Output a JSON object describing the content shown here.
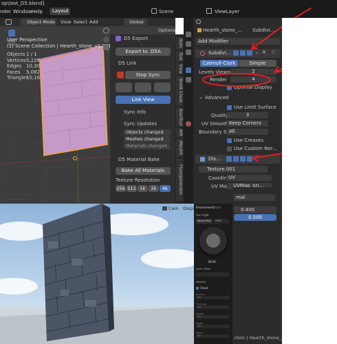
{
  "topbar": {
    "file_title": "op\\test_D5.blend]",
    "menu": [
      "nder",
      "Window",
      "Help"
    ],
    "layout_tab": "Layout",
    "scene": "Scene",
    "view_layer": "ViewLayer"
  },
  "viewport_header": {
    "mode": "Object Mode",
    "menus": [
      "View",
      "Select",
      "Add"
    ],
    "orientation": "Global",
    "options": "Options"
  },
  "overlay": {
    "perspective": "User Perspective",
    "collection": "(1) Scene Collection | Hearth_stone_v1.001",
    "stats": [
      {
        "label": "Objects",
        "value": "1 / 1"
      },
      {
        "label": "Vertices",
        "value": "5,226"
      },
      {
        "label": "Edges",
        "value": "10,30"
      },
      {
        "label": "Faces",
        "value": "5,082"
      },
      {
        "label": "Triangles",
        "value": "10,16"
      }
    ]
  },
  "d5_panel": {
    "export_header": "D5 Export",
    "export_button": "Export to .D5A",
    "link_header": "D5 Link",
    "stop_sync": "Stop Sync",
    "link_view": "Link View",
    "sync_info": "Sync Info",
    "sync_updates": "Sync Updates",
    "sync_items": [
      "Objects changed",
      "Meshes changed",
      "Materials changed"
    ],
    "bake_header": "D5 Material Bake",
    "bake_all": "Bake All Materials",
    "tex_res_label": "Texture Resolution",
    "tex_res_options": [
      "256",
      "512",
      "1k",
      "2k",
      "4k"
    ],
    "tex_res_selected": "4k"
  },
  "side_tabs": [
    "Item",
    "Tool",
    "View",
    "Bresk Clean",
    "BoolTool",
    "AM",
    "iMeshh",
    "Floorgenerator"
  ],
  "properties": {
    "object_name": "Hearth_stone_...",
    "modifier_name": "Subdivi...",
    "add_modifier": "Add Modifier",
    "subsurf_name": "Subdivi...",
    "tabs": [
      "Catmull-Clark",
      "Simple"
    ],
    "levels_viewport_label": "Levels Viewport",
    "levels_viewport": "2",
    "render_label": "Render",
    "render_value": "4",
    "optimal_display": "Optimal Display",
    "advanced": "Advanced",
    "use_limit_surface": "Use Limit Surface",
    "quality_label": "Quality",
    "quality": "3",
    "uv_smooth_label": "UV Smooth",
    "uv_smooth": "Keep Corners",
    "boundary_label": "Boundary S...",
    "boundary": "All",
    "use_creases": "Use Creases",
    "use_custom_normals": "Use Custom Nor...",
    "displace_name": "Dis...",
    "texture": "Texture.001",
    "coordinates_label": "Coordinates",
    "coordinates": "UV",
    "uvmap_label": "UV Map",
    "uvmap": "UVMap_ori..."
  },
  "d5_render": {
    "cam_label": "Cam",
    "display_label": "Dispi",
    "env_tab": "Environment",
    "other_tab": "Other",
    "sky_label": "Sun Light",
    "env_mode": "Record Sky",
    "hdri": "HDRI",
    "time": "18:00",
    "north_offset": "North Offset",
    "weather": "Weather",
    "cloud": "Cloud",
    "params": [
      "Amount",
      "Thickness",
      "Density",
      "Height",
      "Offset"
    ],
    "param_values": [
      "0.5",
      "0.5",
      "0.5",
      "0.5",
      "0.5"
    ],
    "right_field_1": "0.400",
    "right_field_2": "0.500",
    "right_label": "mal",
    "footer": "ction | Hearth_stone_v"
  },
  "colors": {
    "accent": "#4772b3",
    "annotation": "#e02020",
    "stone_pink": "#c79ac9",
    "selection": "#f3a33a"
  }
}
